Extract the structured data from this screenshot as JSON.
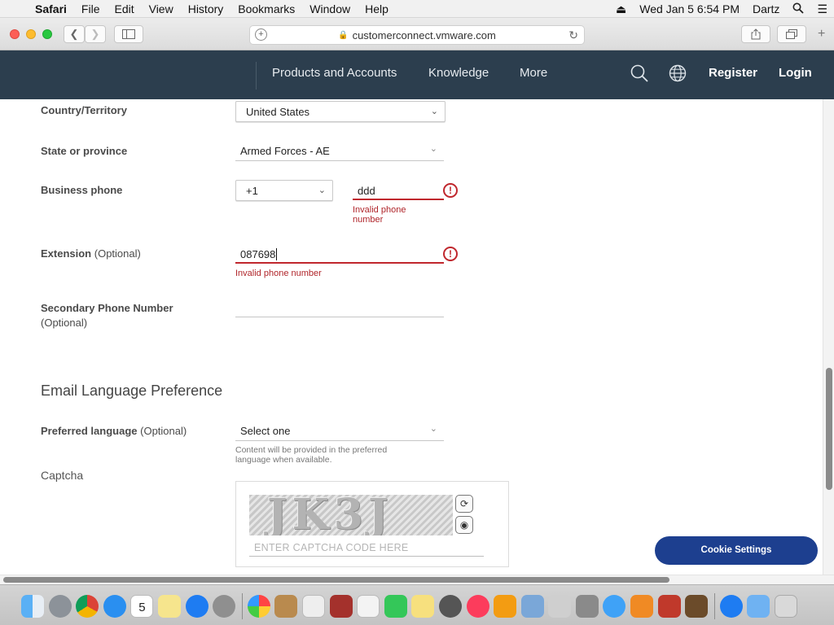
{
  "menubar": {
    "app": "Safari",
    "items": [
      "File",
      "Edit",
      "View",
      "History",
      "Bookmarks",
      "Window",
      "Help"
    ],
    "datetime": "Wed Jan 5  6:54 PM",
    "user": "Dartz"
  },
  "browser": {
    "url": "customerconnect.vmware.com"
  },
  "site_header": {
    "nav": [
      "Products and Accounts",
      "Knowledge",
      "More"
    ],
    "register": "Register",
    "login": "Login"
  },
  "form": {
    "country_label": "Country/Territory",
    "country_value": "United States",
    "state_label": "State or province",
    "state_value": "Armed Forces - AE",
    "business_phone_label": "Business phone",
    "country_code_value": "+1",
    "phone_value": "ddd",
    "phone_error": "Invalid phone number",
    "extension_label": "Extension",
    "optional": "(Optional)",
    "extension_value": "087698",
    "extension_error": "Invalid phone number",
    "secondary_phone_label": "Secondary Phone Number",
    "secondary_phone_optional": "(Optional)",
    "email_section_title": "Email Language Preference",
    "preferred_language_label": "Preferred language",
    "preferred_language_value": "Select one",
    "preferred_language_hint": "Content will be provided in the preferred language when available.",
    "captcha_label": "Captcha",
    "captcha_image_text": "JK3J",
    "captcha_placeholder": "ENTER CAPTCHA CODE HERE"
  },
  "cookie_button": "Cookie Settings"
}
